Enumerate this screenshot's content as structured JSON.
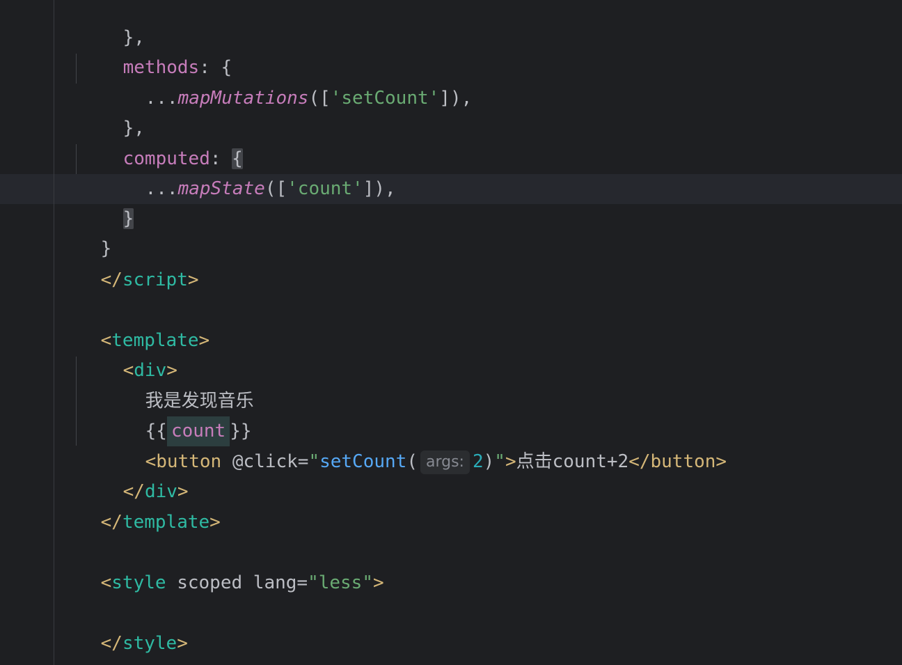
{
  "editor": {
    "lines": {
      "l1_close": "},",
      "l2_methods": "methods",
      "l2_rest": ": {",
      "l3_spread": "...",
      "l3_fn": "mapMutations",
      "l3_open": "([",
      "l3_str": "'setCount'",
      "l3_close": "]),",
      "l4_close": "},",
      "l5_computed": "computed",
      "l5_colon": ": ",
      "l5_brace": "{",
      "l6_spread": "...",
      "l6_fn": "mapState",
      "l6_open": "([",
      "l6_str": "'count'",
      "l6_close": "]),",
      "l7_brace": "}",
      "l8_brace": "}",
      "l9_lt": "</",
      "l9_tag": "script",
      "l9_gt": ">",
      "l11_lt": "<",
      "l11_tag": "template",
      "l11_gt": ">",
      "l12_lt": "<",
      "l12_tag": "div",
      "l12_gt": ">",
      "l13_text": "我是发现音乐",
      "l14_open": "{{",
      "l14_var": "count",
      "l14_close": "}}",
      "l15_lt": "<",
      "l15_tag": "button",
      "l15_attr": " @click",
      "l15_eq": "=",
      "l15_q1": "\"",
      "l15_call": "setCount",
      "l15_paren_open": "(",
      "l15_hint": "args:",
      "l15_num": "2",
      "l15_paren_close": ")",
      "l15_q2": "\"",
      "l15_gt": ">",
      "l15_text_cjk": "点击",
      "l15_text": "count+2",
      "l15_end_lt": "</",
      "l15_end_tag": "button",
      "l15_end_gt": ">",
      "l16_lt": "</",
      "l16_tag": "div",
      "l16_gt": ">",
      "l17_lt": "</",
      "l17_tag": "template",
      "l17_gt": ">",
      "l19_lt": "<",
      "l19_tag": "style",
      "l19_attr1": " scoped lang",
      "l19_eq": "=",
      "l19_val": "\"less\"",
      "l19_gt": ">",
      "l21_lt": "</",
      "l21_tag": "style",
      "l21_gt": ">"
    }
  }
}
